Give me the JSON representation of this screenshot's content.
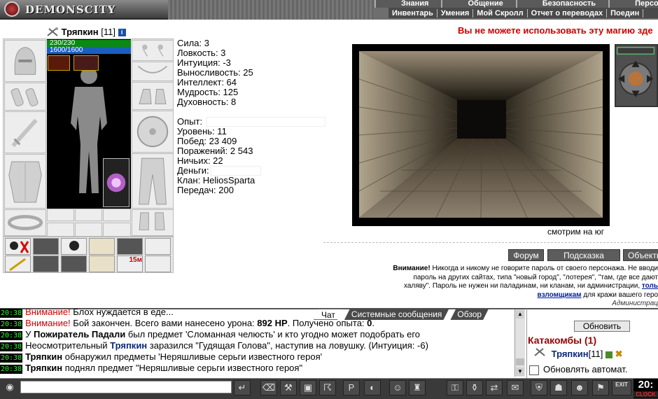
{
  "header": {
    "logo_text": "DEMONSCITY",
    "main_menu": [
      "Знания",
      "Общение",
      "Безопасность",
      "Персонаж"
    ],
    "sub_menu": [
      "Инвентарь",
      "Умения",
      "Мой Скролл",
      "Отчет о переводах",
      "Поедин"
    ]
  },
  "character": {
    "name": "Тряпкин",
    "level": "[11]",
    "info_icon": "i",
    "hp": "230/230",
    "mp": "1600/1600"
  },
  "stats": [
    "Сила: 3",
    "Ловкость: 3",
    "Интуиция: -3",
    "Выносливость: 25",
    "Интеллект: 64",
    "Мудрость: 125",
    "Духовность: 8"
  ],
  "info": {
    "exp_label": "Опыт:",
    "level": "Уровень: 11",
    "wins": "Побед: 23 409",
    "losses": "Поражений: 2 543",
    "draws": "Ничьих: 22",
    "money_label": "Деньги:",
    "clan": "Клан: HeliosSparta",
    "transfers": "Передач: 200"
  },
  "warning": "Вы не можете использовать эту магию зде",
  "view": {
    "direction": "смотрим на юг"
  },
  "nav_buttons": [
    "Форум",
    "Подсказка",
    "Объекты"
  ],
  "notice": {
    "title": "Внимание!",
    "line1": "Никогда и никому не говорите пароль от своего персонажа. Не вводи",
    "line2": "пароль на других сайтах, типа \"новый город\", \"лотерея\", \"там, где все дают",
    "line3a": "халяву\". Пароль не нужен ни паладинам, ни кланам, ни администрации,",
    "line3_link": "толь",
    "line4_link": "взломщикам",
    "line4b": "для кражи вашего геро",
    "signature": "Администрац"
  },
  "chat": {
    "tabs": [
      "Чат",
      "Системные сообщения",
      "Обзор"
    ],
    "lines": [
      {
        "time": "20:38",
        "red": "Внимание!",
        "text": " Блох нуждается в еде..."
      },
      {
        "time": "20:38",
        "red": "Внимание!",
        "text": " Бой закончен. Всего вами нанесено урона: ",
        "bold": "892 HP",
        "text2": ". Получено опыта: ",
        "bold2": "0",
        "text3": "."
      },
      {
        "time": "20:38",
        "pre": "У ",
        "bold": "Пожиратель Падали",
        "text": " был предмет 'Сломанная челюсть' и кто угодно может подобрать его"
      },
      {
        "time": "20:38",
        "pre": "Неосмотрительный ",
        "nick": "Тряпкин",
        "text": " заразился \"Гудящая Голова\", наступив на ловушку. (Интуиция: -6)"
      },
      {
        "time": "20:38",
        "bold": "Тряпкин",
        "text": " обнаружил предметы 'Неряшливые серьги известного героя'"
      },
      {
        "time": "20:38",
        "bold": "Тряпкин",
        "text": " поднял предмет \"Неряшливые серьги известного героя\""
      }
    ]
  },
  "right_panel": {
    "refresh_button": "Обновить",
    "location": "Катакомбы (1)",
    "player_name": "Тряпкин",
    "player_level": "[11]",
    "auto_update_label": "Обновлять автомат."
  },
  "bottom": {
    "clock_time": "20:",
    "clock_label": "CLOCK",
    "exit_label": "EXIT",
    "effect_timer": "15м"
  },
  "colors": {
    "warning": "#cc0000",
    "location": "#9a0000",
    "timestamp_green": "#2ff42f",
    "hp_green": "#0a8a12",
    "mp_blue": "#1a5fbf"
  }
}
